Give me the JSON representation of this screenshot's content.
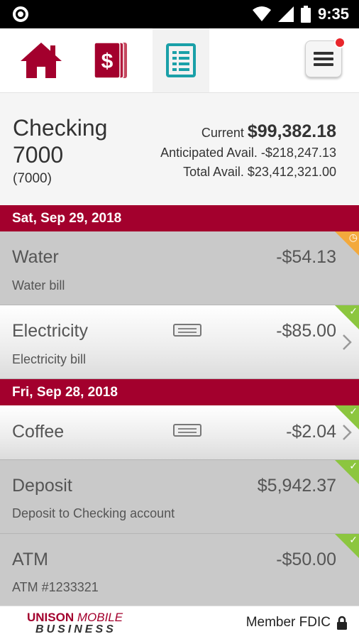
{
  "status_bar": {
    "time": "9:35"
  },
  "nav": {
    "items": [
      {
        "icon": "home-icon"
      },
      {
        "icon": "payments-icon"
      },
      {
        "icon": "account-details-icon"
      }
    ],
    "menu_icon": "hamburger-menu-icon"
  },
  "account": {
    "name": "Checking 7000",
    "number": "(7000)",
    "current_label": "Current",
    "current_value": "$99,382.18",
    "anticipated_label": "Anticipated Avail.",
    "anticipated_value": "-$218,247.13",
    "total_label": "Total Avail.",
    "total_value": "$23,412,321.00"
  },
  "groups": [
    {
      "date": "Sat, Sep 29, 2018",
      "transactions": [
        {
          "name": "Water",
          "description": "Water bill",
          "amount": "-$54.13",
          "status": "pending"
        },
        {
          "name": "Electricity",
          "description": "Electricity bill",
          "amount": "-$85.00",
          "status": "cleared"
        }
      ]
    },
    {
      "date": "Fri, Sep 28, 2018",
      "transactions": [
        {
          "name": "Coffee",
          "description": "",
          "amount": "-$2.04",
          "status": "cleared"
        },
        {
          "name": "Deposit",
          "description": "Deposit to Checking account",
          "amount": "$5,942.37",
          "status": "cleared"
        },
        {
          "name": "ATM",
          "description": "ATM #1233321",
          "amount": "-$50.00",
          "status": "cleared"
        }
      ]
    }
  ],
  "footer": {
    "logo_line1_a": "UNISON",
    "logo_line1_b": "MOBILE",
    "logo_line2": "BUSINESS",
    "fdic": "Member FDIC"
  },
  "colors": {
    "brand": "#a3002d",
    "accent": "#1aa0a8",
    "cleared": "#8cc63f",
    "pending": "#f3a93c"
  }
}
